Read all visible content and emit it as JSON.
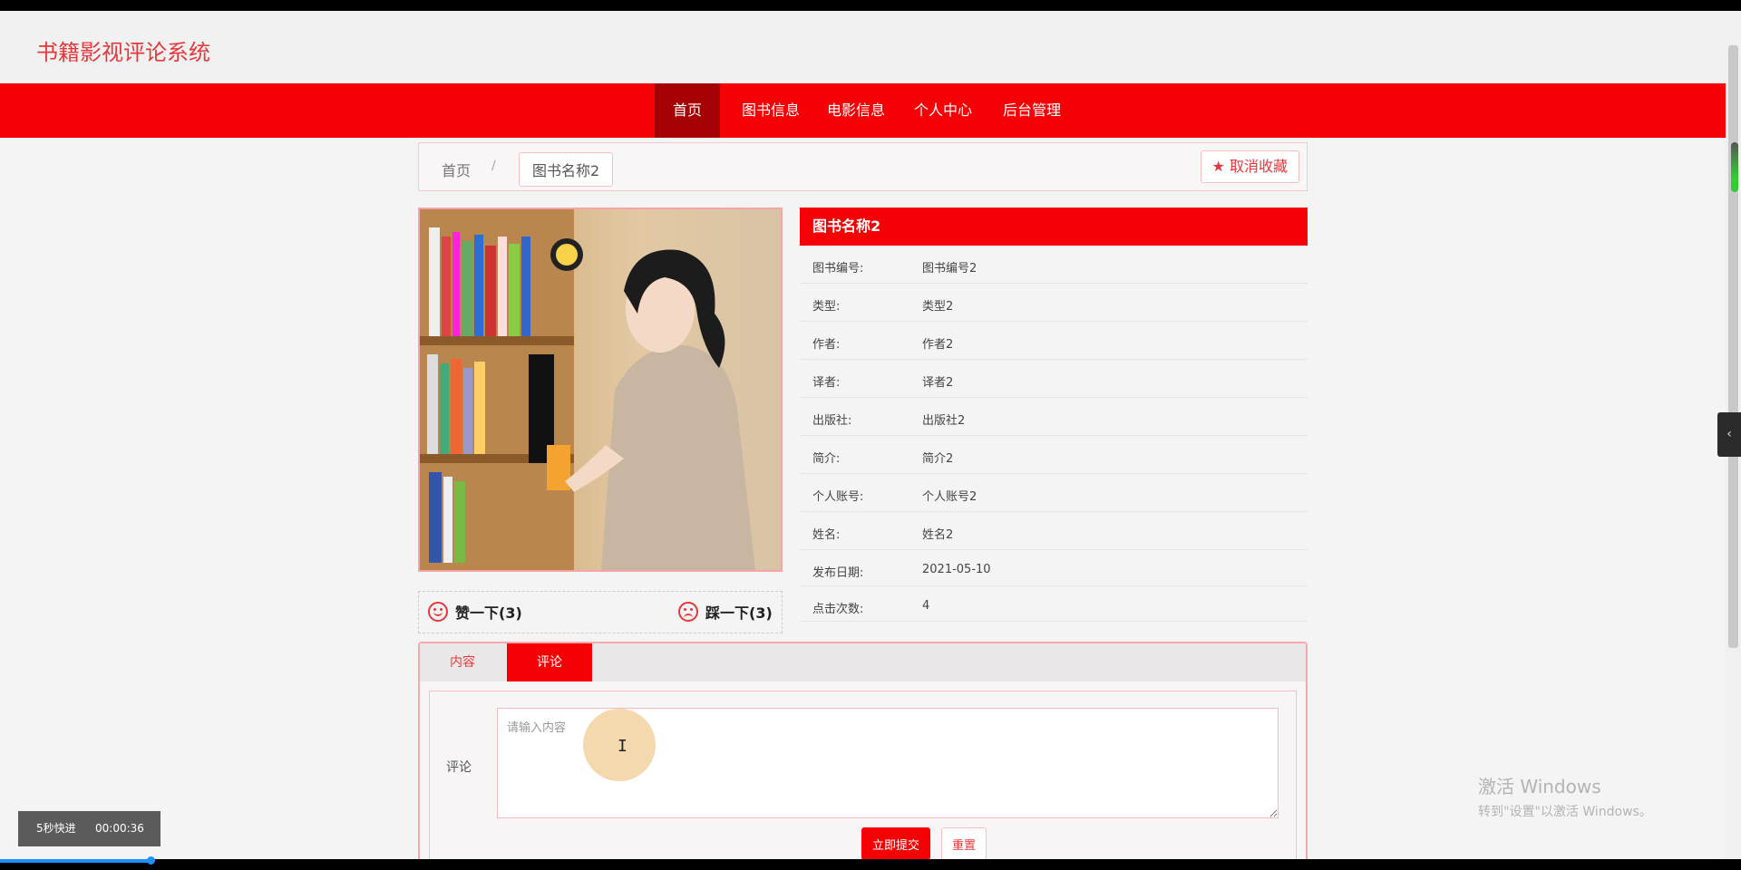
{
  "app": {
    "title": "书籍影视评论系统"
  },
  "nav": {
    "items": [
      {
        "label": "首页",
        "active": true
      },
      {
        "label": "图书信息"
      },
      {
        "label": "电影信息"
      },
      {
        "label": "个人中心"
      },
      {
        "label": "后台管理"
      }
    ]
  },
  "breadcrumb": {
    "home": "首页",
    "separator": "/",
    "current": "图书名称2"
  },
  "favorite": {
    "label": "取消收藏",
    "icon": "star-icon"
  },
  "vote": {
    "like": "赞一下(3)",
    "dislike": "踩一下(3)"
  },
  "detail": {
    "title": "图书名称2",
    "rows": [
      {
        "key": "图书编号:",
        "value": "图书编号2"
      },
      {
        "key": "类型:",
        "value": "类型2"
      },
      {
        "key": "作者:",
        "value": "作者2"
      },
      {
        "key": "译者:",
        "value": "译者2"
      },
      {
        "key": "出版社:",
        "value": "出版社2"
      },
      {
        "key": "简介:",
        "value": "简介2"
      },
      {
        "key": "个人账号:",
        "value": "个人账号2"
      },
      {
        "key": "姓名:",
        "value": "姓名2"
      },
      {
        "key": "发布日期:",
        "value": "2021-05-10"
      },
      {
        "key": "点击次数:",
        "value": "4"
      }
    ]
  },
  "tabs": {
    "content": "内容",
    "comment": "评论"
  },
  "comment_form": {
    "label": "评论",
    "placeholder": "请输入内容",
    "submit": "立即提交",
    "reset": "重置"
  },
  "watermark": {
    "line1": "激活 Windows",
    "line2": "转到\"设置\"以激活 Windows。"
  },
  "player": {
    "fast_forward": "5秒快进",
    "time": "00:00:36"
  },
  "colors": {
    "brand": "#f50004",
    "nav_active": "#a50003",
    "accent_text": "#e4393c"
  }
}
